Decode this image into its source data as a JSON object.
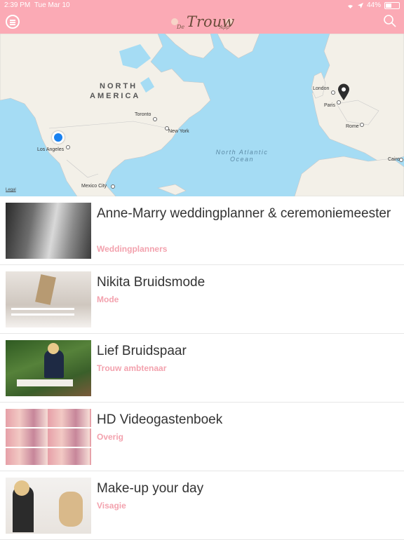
{
  "status_bar": {
    "time": "2:39 PM",
    "date": "Tue Mar 10",
    "battery": "44%"
  },
  "header": {
    "logo_de": "De",
    "logo_name": "Trouw",
    "logo_app": "App"
  },
  "colors": {
    "header": "#fbaab5",
    "accent_text": "#f3a2ae",
    "water": "#a5dcf4",
    "land": "#f3f0e8"
  },
  "icons": {
    "menu": "menu-icon",
    "search": "search-icon",
    "location": "user-location-dot",
    "pin": "map-pin-icon"
  },
  "map": {
    "region_line1": "NORTH",
    "region_line2": "AMERICA",
    "ocean_line1": "North Atlantic",
    "ocean_line2": "Ocean",
    "cities": {
      "toronto": "Toronto",
      "new_york": "New York",
      "los_angeles": "Los Angeles",
      "mexico_city": "Mexico City",
      "london": "London",
      "paris": "Paris",
      "rome": "Rome",
      "cairo": "Cairo"
    },
    "legal": "Legal"
  },
  "items": [
    {
      "title": "Anne-Marry weddingplanner & ceremoniemeester",
      "category": "Weddingplanners"
    },
    {
      "title": "Nikita Bruidsmode",
      "category": "Mode"
    },
    {
      "title": "Lief Bruidspaar",
      "category": "Trouw ambtenaar"
    },
    {
      "title": "HD Videogastenboek",
      "category": "Overig"
    },
    {
      "title": "Make-up your day",
      "category": "Visagie"
    }
  ]
}
